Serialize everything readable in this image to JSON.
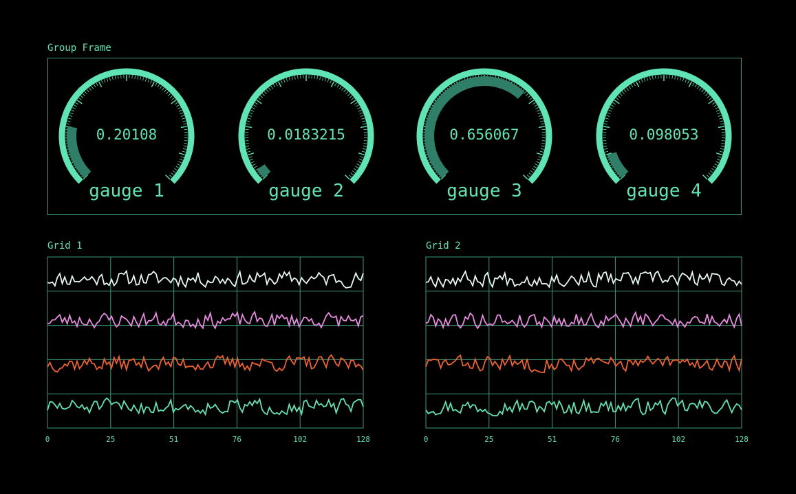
{
  "colors": {
    "accent": "#5fe5b5",
    "frame": "#3a9a7c",
    "gauge_value_fill": "#2f7f68",
    "background": "#000000",
    "series": [
      "#e6f7f2",
      "#e98be0",
      "#f0622a",
      "#5fe5b5"
    ]
  },
  "group_frame": {
    "label": "Group Frame",
    "gauges": [
      {
        "label": "gauge 1",
        "value": 0.20108,
        "display": "0.20108"
      },
      {
        "label": "gauge 2",
        "value": 0.0183215,
        "display": "0.0183215"
      },
      {
        "label": "gauge 3",
        "value": 0.656067,
        "display": "0.656067"
      },
      {
        "label": "gauge 4",
        "value": 0.098053,
        "display": "0.098053"
      }
    ]
  },
  "chart_data": [
    {
      "type": "line",
      "title": "Grid 1",
      "xlim": [
        0,
        128
      ],
      "x_ticks": [
        "0",
        "25",
        "51",
        "76",
        "102",
        "128"
      ],
      "grid": true,
      "series_count": 4,
      "seeds": [
        11,
        23,
        37,
        51
      ]
    },
    {
      "type": "line",
      "title": "Grid 2",
      "xlim": [
        0,
        128
      ],
      "x_ticks": [
        "0",
        "25",
        "51",
        "76",
        "102",
        "128"
      ],
      "grid": true,
      "series_count": 4,
      "seeds": [
        67,
        79,
        83,
        97
      ]
    }
  ]
}
